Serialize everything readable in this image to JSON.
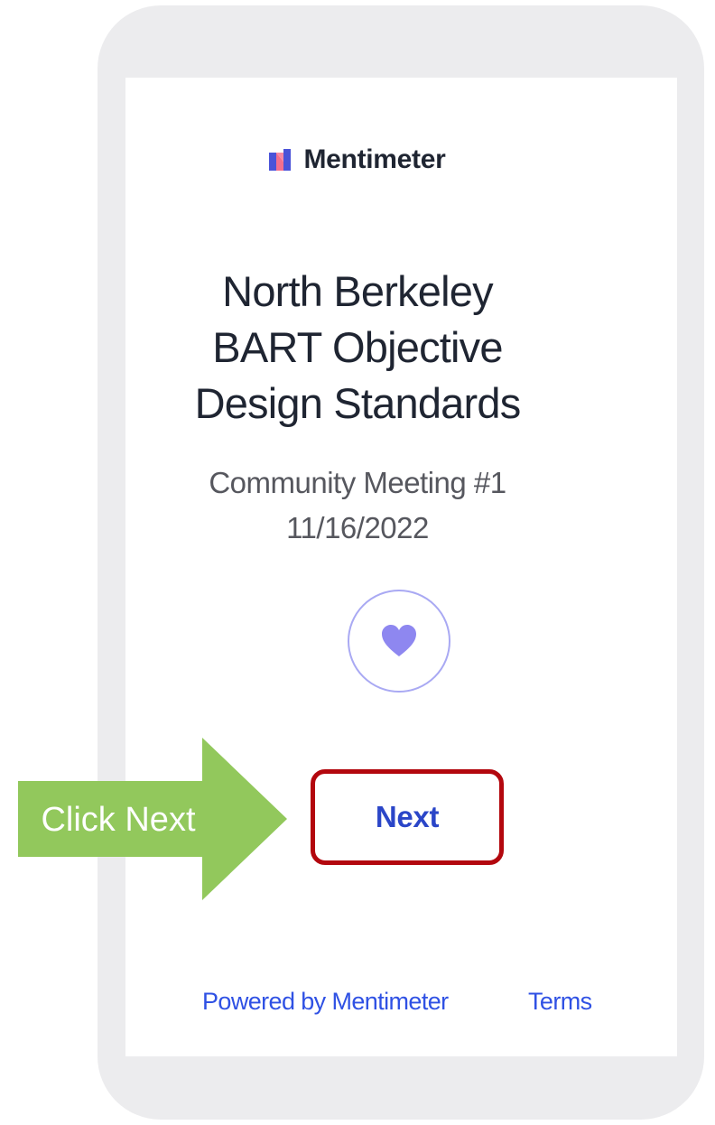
{
  "app": {
    "brand_name": "Mentimeter"
  },
  "presentation": {
    "title_lines": [
      "North Berkeley",
      "BART Objective",
      "Design Standards"
    ],
    "subtitle_lines": [
      "Community Meeting #1",
      "11/16/2022"
    ]
  },
  "actions": {
    "reaction_icon": "heart-icon",
    "next_label": "Next"
  },
  "annotation": {
    "callout_text": "Click Next",
    "callout_color": "#92c85c",
    "highlight_color": "#b3070e"
  },
  "footer": {
    "powered_by": "Powered by Mentimeter",
    "terms": "Terms"
  },
  "colors": {
    "frame": "#ececee",
    "accent_blue": "#2b46c8",
    "heart": "#8e87f0"
  }
}
